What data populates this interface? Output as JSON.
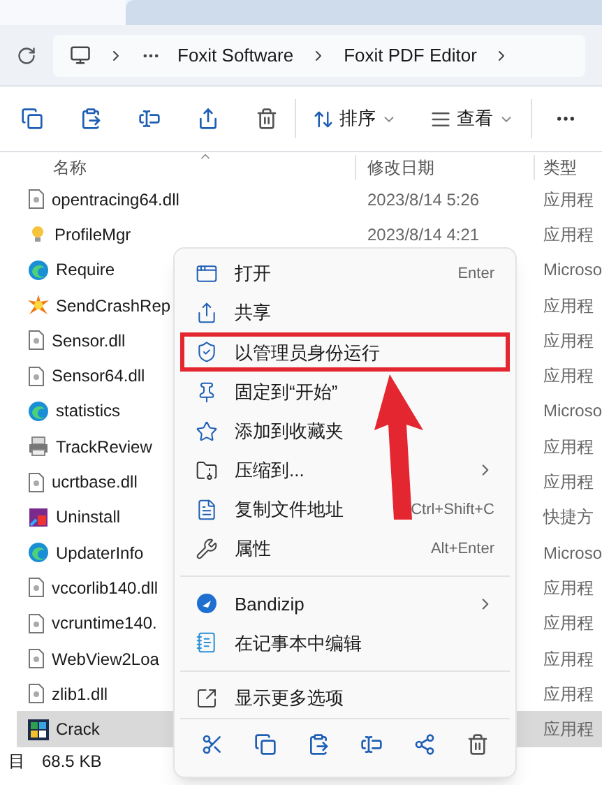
{
  "address_bar": {
    "crumbs": [
      "Foxit Software",
      "Foxit PDF Editor"
    ]
  },
  "toolbar": {
    "sort_label": "排序",
    "view_label": "查看"
  },
  "table": {
    "columns": [
      "名称",
      "修改日期",
      "类型"
    ],
    "rows": [
      {
        "name": "opentracing64.dll",
        "date": "2023/8/14 5:26",
        "type": "应用程",
        "kind": "dll",
        "selected": false
      },
      {
        "name": "ProfileMgr",
        "date": "2023/8/14 4:21",
        "type": "应用程",
        "kind": "bulb",
        "selected": false
      },
      {
        "name": "Require",
        "type": "Microso",
        "kind": "edge",
        "selected": false
      },
      {
        "name": "SendCrashRep",
        "type": "应用程",
        "kind": "crash",
        "selected": false
      },
      {
        "name": "Sensor.dll",
        "type": "应用程",
        "kind": "dll",
        "selected": false
      },
      {
        "name": "Sensor64.dll",
        "type": "应用程",
        "kind": "dll",
        "selected": false
      },
      {
        "name": "statistics",
        "type": "Microso",
        "kind": "edge",
        "selected": false
      },
      {
        "name": "TrackReview",
        "type": "应用程",
        "kind": "printer",
        "selected": false
      },
      {
        "name": "ucrtbase.dll",
        "type": "应用程",
        "kind": "dll",
        "selected": false
      },
      {
        "name": "Uninstall",
        "type": "快捷方",
        "kind": "uninstall",
        "selected": false
      },
      {
        "name": "UpdaterInfo",
        "type": "Microso",
        "kind": "edge",
        "selected": false
      },
      {
        "name": "vccorlib140.dll",
        "type": "应用程",
        "kind": "dll",
        "selected": false
      },
      {
        "name": "vcruntime140.",
        "type": "应用程",
        "kind": "dll",
        "selected": false
      },
      {
        "name": "WebView2Loa",
        "type": "应用程",
        "kind": "dll",
        "selected": false
      },
      {
        "name": "zlib1.dll",
        "type": "应用程",
        "kind": "dll",
        "selected": false
      },
      {
        "name": "Crack",
        "type": "应用程",
        "kind": "app",
        "selected": true
      }
    ]
  },
  "status_bar": {
    "text": "目",
    "size": "68.5 KB"
  },
  "context_menu": {
    "items": [
      {
        "kind": "item",
        "label": "打开",
        "shortcut": "Enter",
        "highlighted": false
      },
      {
        "kind": "item",
        "label": "共享",
        "highlighted": false
      },
      {
        "kind": "item",
        "label": "以管理员身份运行",
        "highlighted": true
      },
      {
        "kind": "item",
        "label": "固定到“开始”",
        "highlighted": false
      },
      {
        "kind": "item",
        "label": "添加到收藏夹",
        "highlighted": false
      },
      {
        "kind": "submenu",
        "label": "压缩到...",
        "highlighted": false
      },
      {
        "kind": "item",
        "label": "复制文件地址",
        "shortcut": "Ctrl+Shift+C",
        "highlighted": false
      },
      {
        "kind": "item",
        "label": "属性",
        "shortcut": "Alt+Enter",
        "highlighted": false
      },
      {
        "kind": "divider"
      },
      {
        "kind": "submenu",
        "label": "Bandizip",
        "highlighted": false
      },
      {
        "kind": "item",
        "label": "在记事本中编辑",
        "highlighted": false
      },
      {
        "kind": "divider"
      },
      {
        "kind": "item",
        "label": "显示更多选项",
        "highlighted": false
      }
    ]
  }
}
